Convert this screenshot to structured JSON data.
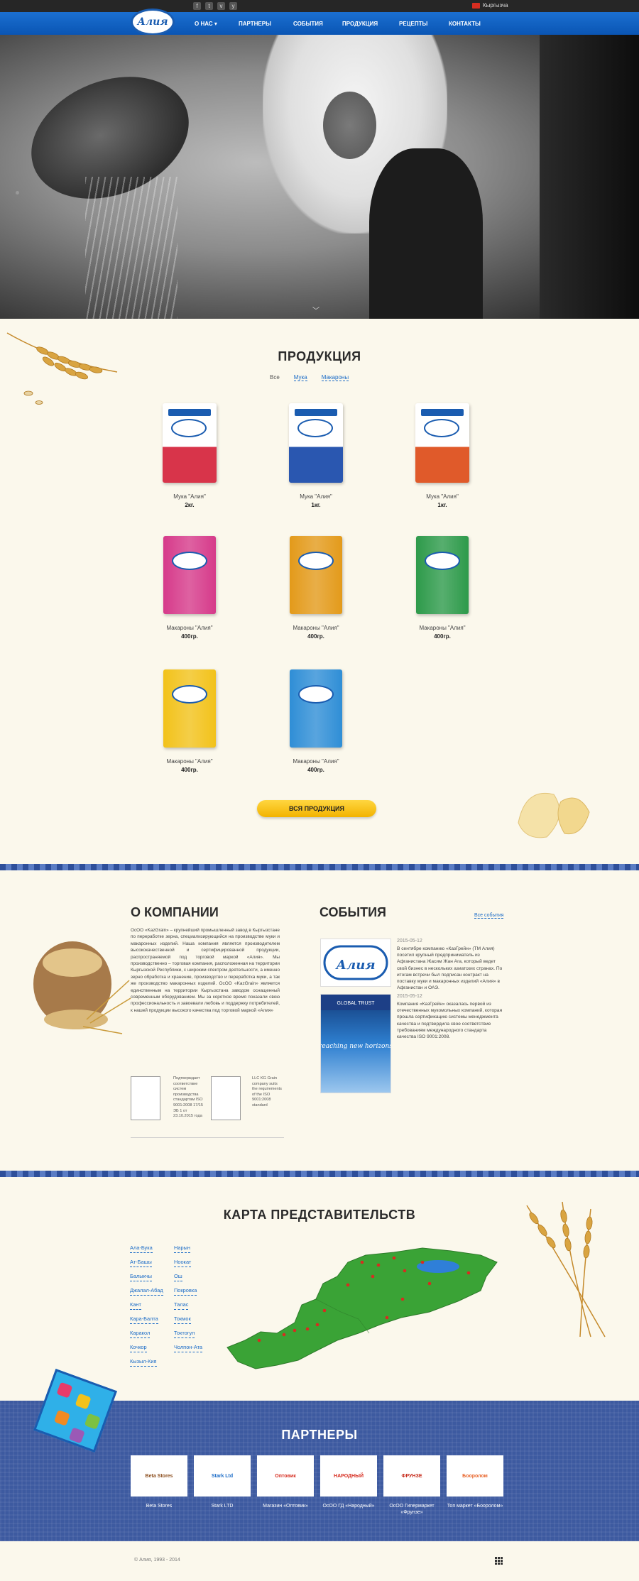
{
  "topbar": {
    "socials": [
      "f",
      "t",
      "v",
      "y"
    ],
    "language": "Кыргызча"
  },
  "nav": {
    "logo_text": "Алия",
    "items": [
      "О НАС",
      "ПАРТНЕРЫ",
      "СОБЫТИЯ",
      "ПРОДУКЦИЯ",
      "РЕЦЕПТЫ",
      "КОНТАКТЫ"
    ],
    "dropdown_icon": "chevron-down-icon"
  },
  "products": {
    "title": "ПРОДУКЦИЯ",
    "filters": [
      "Все",
      "Мука",
      "Макароны"
    ],
    "items": [
      {
        "name": "Мука \"Алия\"",
        "weight": "2кг.",
        "color": "#d8344a",
        "kind": "flour"
      },
      {
        "name": "Мука \"Алия\"",
        "weight": "1кг.",
        "color": "#2a57b0",
        "kind": "flour"
      },
      {
        "name": "Мука \"Алия\"",
        "weight": "1кг.",
        "color": "#e05a2a",
        "kind": "flour"
      },
      {
        "name": "Макароны \"Алия\"",
        "weight": "400гр.",
        "color": "#d63a8a",
        "kind": "pasta"
      },
      {
        "name": "Макароны \"Алия\"",
        "weight": "400гр.",
        "color": "#e39a1a",
        "kind": "pasta"
      },
      {
        "name": "Макароны \"Алия\"",
        "weight": "400гр.",
        "color": "#2d9a4a",
        "kind": "pasta"
      },
      {
        "name": "Макароны \"Алия\"",
        "weight": "400гр.",
        "color": "#f2c21a",
        "kind": "pasta"
      },
      {
        "name": "Макароны \"Алия\"",
        "weight": "400гр.",
        "color": "#2f8ed6",
        "kind": "pasta"
      }
    ],
    "all_button": "ВСЯ ПРОДУКЦИЯ"
  },
  "about": {
    "title": "О КОМПАНИИ",
    "text": "ОсОО «KazGrain» – крупнейший промышленный завод в Кыргызстане по переработке зерна, специализирующийся на производстве муки и макаронных изделий. Наша компания является производителем высококачественной и сертифицированной продукции, распространяемой под торговой маркой «Алия». Мы производственно – торговая компания, расположенная на территории Кыргызской Республики, с широким спектром деятельности, а именно зерно обработка и хранение, производство и переработка муки, а так же производство макаронных изделий. ОсОО «KazGrain» является единственным на территории Кыргызстана заводом оснащенный современным оборудованием. Мы за короткое время показали свою профессиональность и завоевали любовь и поддержку потребителей, к нашей продукции высокого качества под торговой маркой «Алия»",
    "cert1_text": "Подтверждает соответствие систем производства стандартам ISO 9001:2008 17/15 ЭБ 1 от 23.10.2015 года",
    "cert2_text": "LLC KG Grain company suits the requirements of the ISO 9001:2008 standard"
  },
  "events": {
    "title": "СОБЫТИЯ",
    "all_link": "Все события",
    "items": [
      {
        "date": "2015-05-12",
        "text": "В сентябре компанию «КазГрейн» (ТМ Алия) посетил крупный предприниматель из Афганистана Жасим Жан Ага, который ведет свой бизнес в нескольких азиатских странах. По итогам встречи был подписан контракт на поставку муки и макаронных изделий «Алия» в Афганистан и ОАЭ."
      },
      {
        "date": "2015-05-12",
        "text": "Компания «КазГрейн» оказалась первой из отечественных мукомольных компаний, которая прошла сертификацию системы менеджмента качества и подтвердила свое соответствие требованиям международного стандарта качества ISO 9001:2008."
      }
    ],
    "event2_banner": "GLOBAL TRUST",
    "event2_caption": "reaching new horizons"
  },
  "map": {
    "title": "КАРТА ПРЕДСТАВИТЕЛЬСТВ",
    "cities_col1": [
      "Ала-Бука",
      "Ат-Башы",
      "Балыкчы",
      "Джалал-Абад",
      "Кант",
      "Кара-Балта",
      "Каракол",
      "Кочкор",
      "Кызыл-Кия"
    ],
    "cities_col2": [
      "Нарын",
      "Ноокат",
      "Ош",
      "Покровка",
      "Талас",
      "Токмок",
      "Токтогул",
      "Чолпон-Ата"
    ],
    "colors": {
      "land": "#3aa336",
      "lake": "#2f7fd8",
      "marker": "#d62d20"
    }
  },
  "partners": {
    "title": "ПАРТНЕРЫ",
    "items": [
      {
        "logo": "Beta Stores",
        "name": "Beta Stores",
        "color": "#8a4b1a"
      },
      {
        "logo": "Stark Ltd",
        "name": "Stark LTD",
        "color": "#1a6bc7"
      },
      {
        "logo": "Оптовик",
        "name": "Магазин «Оптовик»",
        "color": "#d62d20"
      },
      {
        "logo": "НАРОДНЫЙ",
        "name": "ОсОО ГД «Народный»",
        "color": "#d62d20"
      },
      {
        "logo": "ФРУНЗЕ",
        "name": "ОсОО Гипермаркет «Фрунзе»",
        "color": "#c62a1a"
      },
      {
        "logo": "Бооролом",
        "name": "Топ маркет «Бооролом»",
        "color": "#e8642a"
      }
    ]
  },
  "footer": {
    "copyright": "© Алия, 1993 - 2014"
  }
}
